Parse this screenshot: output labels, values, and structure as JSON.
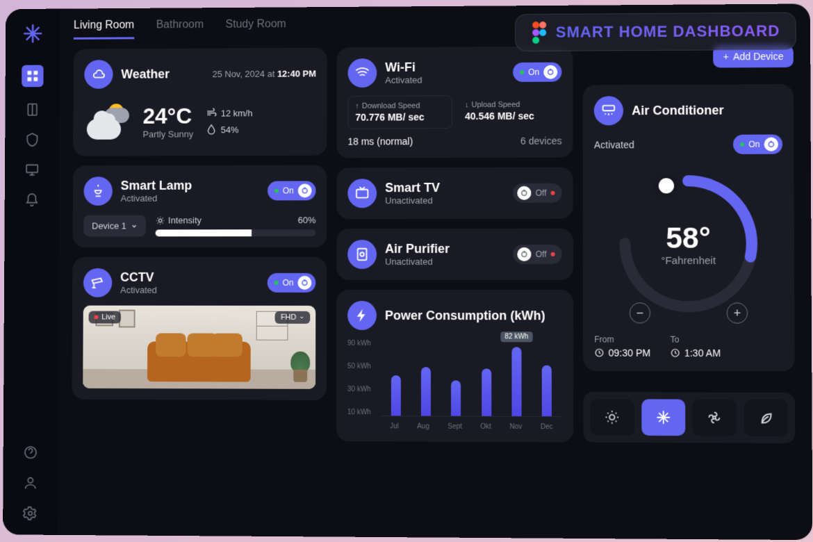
{
  "banner": {
    "title": "SMART HOME DASHBOARD"
  },
  "tabs": [
    "Living Room",
    "Bathroom",
    "Study Room"
  ],
  "active_tab": 0,
  "add_device_label": "Add Device",
  "weather": {
    "title": "Weather",
    "date": "25 Nov, 2024 at",
    "time": "12:40 PM",
    "temp": "24°C",
    "condition": "Partly Sunny",
    "wind": "12 km/h",
    "humidity": "54%"
  },
  "lamp": {
    "title": "Smart Lamp",
    "status": "Activated",
    "toggle": "On",
    "device": "Device 1",
    "intensity_label": "Intensity",
    "intensity": "60%"
  },
  "cctv": {
    "title": "CCTV",
    "status": "Activated",
    "toggle": "On",
    "live": "Live",
    "quality": "FHD"
  },
  "wifi": {
    "title": "Wi-Fi",
    "status": "Activated",
    "toggle": "On",
    "download_label": "Download Speed",
    "download": "70.776 MB/ sec",
    "upload_label": "Upload Speed",
    "upload": "40.546 MB/ sec",
    "ping": "18 ms (normal)",
    "devices": "6 devices"
  },
  "tv": {
    "title": "Smart TV",
    "status": "Unactivated",
    "toggle": "Off"
  },
  "purifier": {
    "title": "Air Purifier",
    "status": "Unactivated",
    "toggle": "Off"
  },
  "power": {
    "title": "Power Consumption (kWh)",
    "highlight_value": "82 kWh"
  },
  "chart_data": {
    "type": "bar",
    "categories": [
      "Jul",
      "Aug",
      "Sept",
      "Okt",
      "Nov",
      "Dec"
    ],
    "values": [
      48,
      58,
      42,
      56,
      82,
      60
    ],
    "ylabel": "kWh",
    "y_ticks": [
      "90 kWh",
      "50 kWh",
      "30 kWh",
      "10 kWh"
    ],
    "ylim": [
      0,
      90
    ],
    "highlight_index": 4
  },
  "ac": {
    "title": "Air Conditioner",
    "status": "Activated",
    "toggle": "On",
    "temp": "58°",
    "unit": "°Fahrenheit",
    "from_label": "From",
    "from": "09:30 PM",
    "to_label": "To",
    "to": "1:30 AM",
    "modes": [
      "sun",
      "snowflake",
      "fan",
      "leaf"
    ],
    "active_mode": 1
  },
  "colors": {
    "accent": "#6366f1",
    "bg": "#0d0d14",
    "card": "#1a1a24"
  }
}
